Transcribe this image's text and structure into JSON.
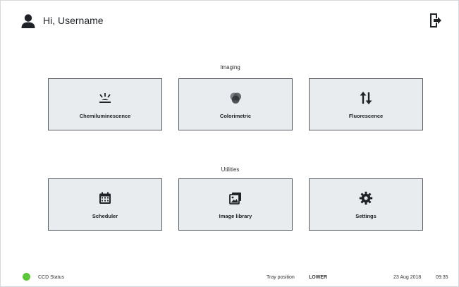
{
  "header": {
    "greeting": "Hi, Username"
  },
  "sections": {
    "imaging_label": "Imaging",
    "utilities_label": "Utilities"
  },
  "imaging": {
    "tiles": [
      {
        "label": "Chemiluminescence",
        "icon": "chemiluminescence-icon"
      },
      {
        "label": "Colorimetric",
        "icon": "colorimetric-icon"
      },
      {
        "label": "Fluorescence",
        "icon": "fluorescence-arrows-icon"
      }
    ]
  },
  "utilities": {
    "tiles": [
      {
        "label": "Scheduler",
        "icon": "calendar-icon"
      },
      {
        "label": "Image library",
        "icon": "image-library-icon"
      },
      {
        "label": "Settings",
        "icon": "gear-icon"
      }
    ]
  },
  "status": {
    "ccd_label": "CCD Status",
    "ccd_color": "#5cc73a",
    "tray_label": "Tray position",
    "tray_value": "LOWER",
    "date": "23 Aug 2018",
    "time": "09:35"
  },
  "colors": {
    "tile_bg": "#e9ecef",
    "tile_border": "#555a60",
    "accent_dark": "#1f2328"
  }
}
